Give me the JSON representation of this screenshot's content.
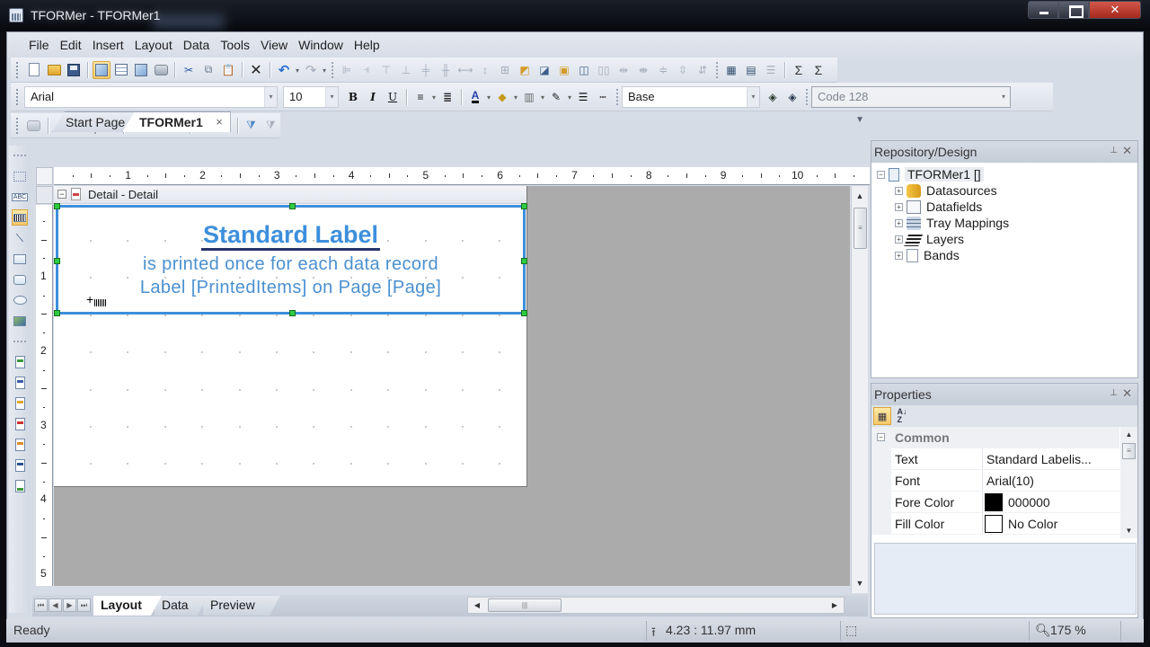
{
  "window": {
    "title": "TFORMer - TFORMer1",
    "controls": [
      "minimize",
      "maximize",
      "close"
    ]
  },
  "menubar": {
    "items": [
      "File",
      "Edit",
      "Insert",
      "Layout",
      "Data",
      "Tools",
      "View",
      "Window",
      "Help"
    ]
  },
  "toolbar_standard": {
    "icons": [
      "new-icon",
      "open-icon",
      "save-icon",
      "layout-view-icon",
      "data-view-icon",
      "preview-icon",
      "print-icon",
      "cut-icon",
      "copy-icon",
      "paste-icon",
      "delete-icon",
      "undo-icon",
      "redo-icon"
    ],
    "layout_icons": [
      "align-left-icon",
      "align-right-icon",
      "align-top-icon",
      "align-bottom-icon",
      "align-center-vertical-icon",
      "align-center-horizontal-icon",
      "same-width-icon",
      "same-height-icon",
      "same-size-icon",
      "bring-to-front-icon",
      "send-to-back-icon",
      "bring-forward-icon",
      "send-backward-icon",
      "space-horizontal-icon",
      "increase-horizontal-space-icon",
      "decrease-horizontal-space-icon",
      "space-vertical-icon",
      "increase-vertical-space-icon",
      "decrease-vertical-space-icon",
      "grid-icon",
      "properties-icon",
      "tab-order-icon",
      "sum-before-icon",
      "sum-after-icon"
    ]
  },
  "toolbar_format": {
    "font_family": "Arial",
    "font_size": "10",
    "bold": "B",
    "italic": "I",
    "underline": "U",
    "layer": "Base",
    "barcode_type": "Code 128"
  },
  "toolbar_data": {
    "icons": [
      "printer-icon",
      "folder-icon",
      "add-datafield-icon",
      "refresh-icon",
      "add-field-icon",
      "add-datasource-icon",
      "datasource-options-icon",
      "edit-icon",
      "edit-settings-icon",
      "filter-icon",
      "filter-clear-icon"
    ]
  },
  "document_tabs": {
    "tabs": [
      {
        "label": "Start Page",
        "active": false
      },
      {
        "label": "TFORMer1",
        "active": true,
        "close": "×"
      }
    ]
  },
  "ruler": {
    "horizontal_labels": [
      "1",
      "2",
      "3",
      "4",
      "5",
      "6",
      "7",
      "8",
      "9",
      "10",
      "1"
    ],
    "vertical_labels": [
      "1",
      "2",
      "3",
      "4",
      "5"
    ]
  },
  "band": {
    "title": "Detail - Detail"
  },
  "label_element": {
    "title": "Standard Label",
    "line1": "is printed once for each data record",
    "line2": "Label [PrintedItems] on Page [Page]",
    "selection_color": "#3d8fdc"
  },
  "bottom_tabs": {
    "tabs": [
      "Layout",
      "Data",
      "Preview"
    ],
    "active": "Layout"
  },
  "repository": {
    "title": "Repository/Design",
    "root": "TFORMer1 []",
    "children": [
      "Datasources",
      "Datafields",
      "Tray Mappings",
      "Layers",
      "Bands"
    ]
  },
  "properties": {
    "title": "Properties",
    "category": "Common",
    "rows": [
      {
        "name": "Text",
        "value": "Standard Labelis..."
      },
      {
        "name": "Font",
        "value": "Arial(10)"
      },
      {
        "name": "Fore Color",
        "value": "000000",
        "swatch": "#000000"
      },
      {
        "name": "Fill Color",
        "value": "No Color",
        "swatch": "#ffffff"
      }
    ]
  },
  "statusbar": {
    "status": "Ready",
    "position": "4.23 : 11.97 mm",
    "zoom": "175 %"
  }
}
